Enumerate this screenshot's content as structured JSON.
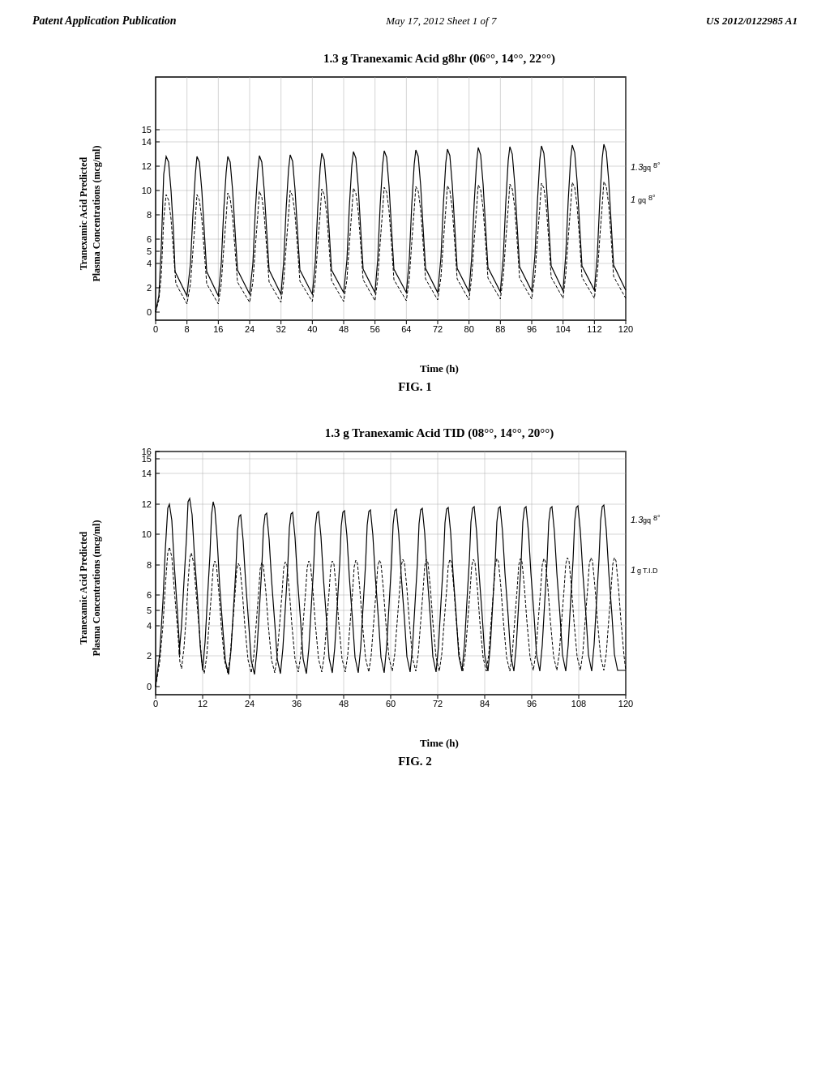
{
  "header": {
    "left": "Patent Application Publication",
    "center": "May 17, 2012   Sheet 1 of 7",
    "right": "US 2012/0122985 A1"
  },
  "fig1": {
    "title": "1.3 g Tranexamic Acid g8hr (06°°, 14°°, 22°°)",
    "caption": "FIG. 1",
    "y_axis_label": "Tranexamic Acid Predicted\nPlasma Concentrations (mcg/ml)",
    "x_axis_label": "Time (h)",
    "y_ticks": [
      "0",
      "2",
      "4",
      "5",
      "6",
      "8",
      "10",
      "12",
      "14",
      "15"
    ],
    "x_ticks": [
      "0",
      "8",
      "16",
      "24",
      "32",
      "40",
      "48",
      "56",
      "64",
      "72",
      "80",
      "88",
      "96",
      "104",
      "112",
      "120"
    ],
    "legend": [
      "1.3gq8°",
      "1gq8°"
    ]
  },
  "fig2": {
    "title": "1.3 g Tranexamic Acid TID (08°°, 14°°, 20°°)",
    "caption": "FIG. 2",
    "y_axis_label": "Tranexamic Acid Predicted\nPlasma Concentrations (mcg/ml)",
    "x_axis_label": "Time (h)",
    "y_ticks": [
      "0",
      "2",
      "4",
      "5",
      "6",
      "8",
      "10",
      "12",
      "14",
      "15",
      "16"
    ],
    "x_ticks": [
      "0",
      "12",
      "24",
      "36",
      "48",
      "60",
      "72",
      "84",
      "96",
      "108",
      "120"
    ],
    "legend": [
      "1.3gq8°",
      "1gT.I.D"
    ]
  }
}
